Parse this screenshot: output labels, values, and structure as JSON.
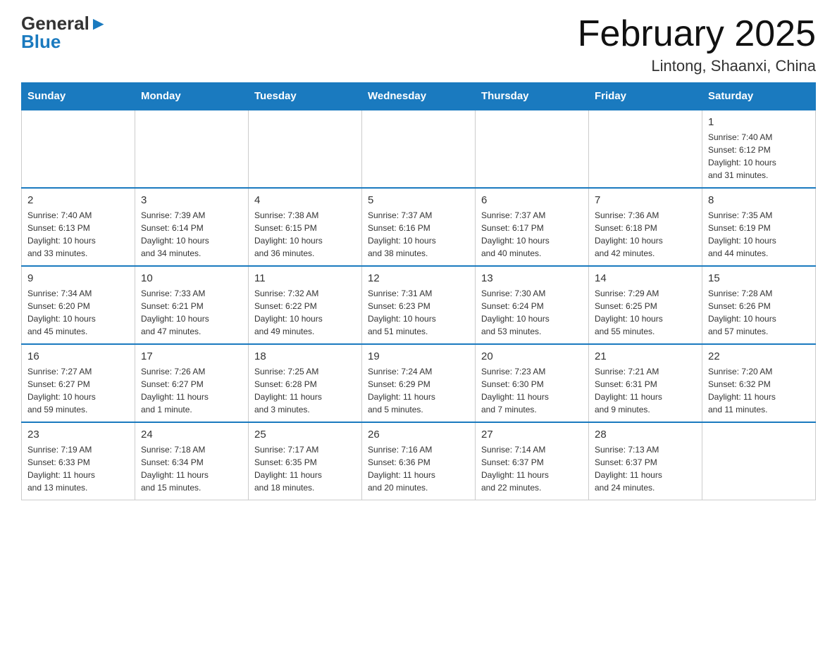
{
  "header": {
    "logo_general": "General",
    "logo_blue": "Blue",
    "month_year": "February 2025",
    "location": "Lintong, Shaanxi, China"
  },
  "days_of_week": [
    "Sunday",
    "Monday",
    "Tuesday",
    "Wednesday",
    "Thursday",
    "Friday",
    "Saturday"
  ],
  "weeks": [
    [
      {
        "day": "",
        "info": ""
      },
      {
        "day": "",
        "info": ""
      },
      {
        "day": "",
        "info": ""
      },
      {
        "day": "",
        "info": ""
      },
      {
        "day": "",
        "info": ""
      },
      {
        "day": "",
        "info": ""
      },
      {
        "day": "1",
        "info": "Sunrise: 7:40 AM\nSunset: 6:12 PM\nDaylight: 10 hours\nand 31 minutes."
      }
    ],
    [
      {
        "day": "2",
        "info": "Sunrise: 7:40 AM\nSunset: 6:13 PM\nDaylight: 10 hours\nand 33 minutes."
      },
      {
        "day": "3",
        "info": "Sunrise: 7:39 AM\nSunset: 6:14 PM\nDaylight: 10 hours\nand 34 minutes."
      },
      {
        "day": "4",
        "info": "Sunrise: 7:38 AM\nSunset: 6:15 PM\nDaylight: 10 hours\nand 36 minutes."
      },
      {
        "day": "5",
        "info": "Sunrise: 7:37 AM\nSunset: 6:16 PM\nDaylight: 10 hours\nand 38 minutes."
      },
      {
        "day": "6",
        "info": "Sunrise: 7:37 AM\nSunset: 6:17 PM\nDaylight: 10 hours\nand 40 minutes."
      },
      {
        "day": "7",
        "info": "Sunrise: 7:36 AM\nSunset: 6:18 PM\nDaylight: 10 hours\nand 42 minutes."
      },
      {
        "day": "8",
        "info": "Sunrise: 7:35 AM\nSunset: 6:19 PM\nDaylight: 10 hours\nand 44 minutes."
      }
    ],
    [
      {
        "day": "9",
        "info": "Sunrise: 7:34 AM\nSunset: 6:20 PM\nDaylight: 10 hours\nand 45 minutes."
      },
      {
        "day": "10",
        "info": "Sunrise: 7:33 AM\nSunset: 6:21 PM\nDaylight: 10 hours\nand 47 minutes."
      },
      {
        "day": "11",
        "info": "Sunrise: 7:32 AM\nSunset: 6:22 PM\nDaylight: 10 hours\nand 49 minutes."
      },
      {
        "day": "12",
        "info": "Sunrise: 7:31 AM\nSunset: 6:23 PM\nDaylight: 10 hours\nand 51 minutes."
      },
      {
        "day": "13",
        "info": "Sunrise: 7:30 AM\nSunset: 6:24 PM\nDaylight: 10 hours\nand 53 minutes."
      },
      {
        "day": "14",
        "info": "Sunrise: 7:29 AM\nSunset: 6:25 PM\nDaylight: 10 hours\nand 55 minutes."
      },
      {
        "day": "15",
        "info": "Sunrise: 7:28 AM\nSunset: 6:26 PM\nDaylight: 10 hours\nand 57 minutes."
      }
    ],
    [
      {
        "day": "16",
        "info": "Sunrise: 7:27 AM\nSunset: 6:27 PM\nDaylight: 10 hours\nand 59 minutes."
      },
      {
        "day": "17",
        "info": "Sunrise: 7:26 AM\nSunset: 6:27 PM\nDaylight: 11 hours\nand 1 minute."
      },
      {
        "day": "18",
        "info": "Sunrise: 7:25 AM\nSunset: 6:28 PM\nDaylight: 11 hours\nand 3 minutes."
      },
      {
        "day": "19",
        "info": "Sunrise: 7:24 AM\nSunset: 6:29 PM\nDaylight: 11 hours\nand 5 minutes."
      },
      {
        "day": "20",
        "info": "Sunrise: 7:23 AM\nSunset: 6:30 PM\nDaylight: 11 hours\nand 7 minutes."
      },
      {
        "day": "21",
        "info": "Sunrise: 7:21 AM\nSunset: 6:31 PM\nDaylight: 11 hours\nand 9 minutes."
      },
      {
        "day": "22",
        "info": "Sunrise: 7:20 AM\nSunset: 6:32 PM\nDaylight: 11 hours\nand 11 minutes."
      }
    ],
    [
      {
        "day": "23",
        "info": "Sunrise: 7:19 AM\nSunset: 6:33 PM\nDaylight: 11 hours\nand 13 minutes."
      },
      {
        "day": "24",
        "info": "Sunrise: 7:18 AM\nSunset: 6:34 PM\nDaylight: 11 hours\nand 15 minutes."
      },
      {
        "day": "25",
        "info": "Sunrise: 7:17 AM\nSunset: 6:35 PM\nDaylight: 11 hours\nand 18 minutes."
      },
      {
        "day": "26",
        "info": "Sunrise: 7:16 AM\nSunset: 6:36 PM\nDaylight: 11 hours\nand 20 minutes."
      },
      {
        "day": "27",
        "info": "Sunrise: 7:14 AM\nSunset: 6:37 PM\nDaylight: 11 hours\nand 22 minutes."
      },
      {
        "day": "28",
        "info": "Sunrise: 7:13 AM\nSunset: 6:37 PM\nDaylight: 11 hours\nand 24 minutes."
      },
      {
        "day": "",
        "info": ""
      }
    ]
  ]
}
